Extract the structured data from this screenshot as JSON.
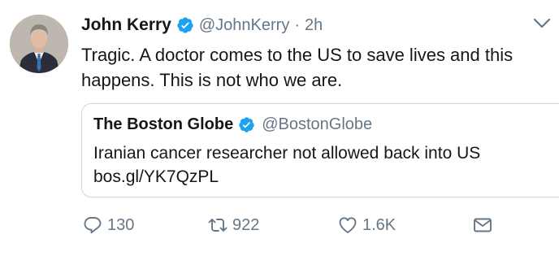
{
  "tweet": {
    "author": {
      "display_name": "John Kerry",
      "handle": "@JohnKerry",
      "separator": "·",
      "time": "2h",
      "verified": true
    },
    "text": "Tragic. A doctor comes to the US to save lives and this happens. This is not who we are.",
    "quoted": {
      "display_name": "The Boston Globe",
      "handle": "@BostonGlobe",
      "verified": true,
      "text_line1": "Iranian cancer researcher not allowed back into US",
      "text_line2": "bos.gl/YK7QzPL"
    },
    "actions": {
      "reply_count": "130",
      "retweet_count": "922",
      "like_count": "1.6K"
    },
    "icons": {
      "reply": "reply-icon",
      "retweet": "retweet-icon",
      "like": "heart-icon",
      "dm": "envelope-icon",
      "menu": "chevron-down-icon",
      "verified": "verified-badge-icon"
    },
    "colors": {
      "verified_blue": "#1da1f2",
      "secondary_text": "#657786",
      "primary_text": "#14171a",
      "border": "#ccd6dd"
    }
  }
}
